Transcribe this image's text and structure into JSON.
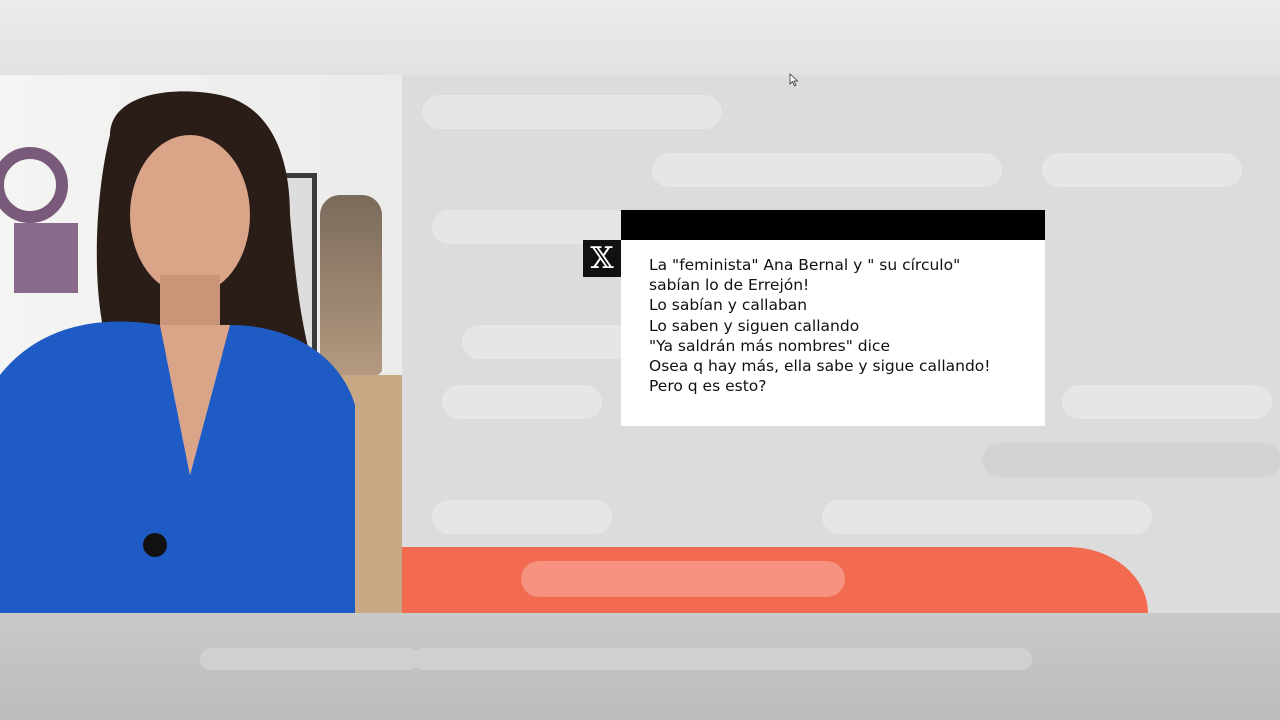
{
  "tweet": {
    "platform_icon": "x-logo-icon",
    "platform_glyph": "𝕏",
    "lines": [
      "La \"feminista\" Ana Bernal y \" su círculo\"",
      "sabían lo de Errejón!",
      "Lo sabían y callaban",
      "Lo saben y siguen callando",
      "\"Ya saldrán más nombres\" dice",
      "Osea q hay más, ella sabe y sigue callando!",
      "Pero q es esto?"
    ]
  },
  "colors": {
    "accent_orange": "#f26a4f",
    "tweet_header": "#000000",
    "shirt_blue": "#1f5bc4"
  }
}
